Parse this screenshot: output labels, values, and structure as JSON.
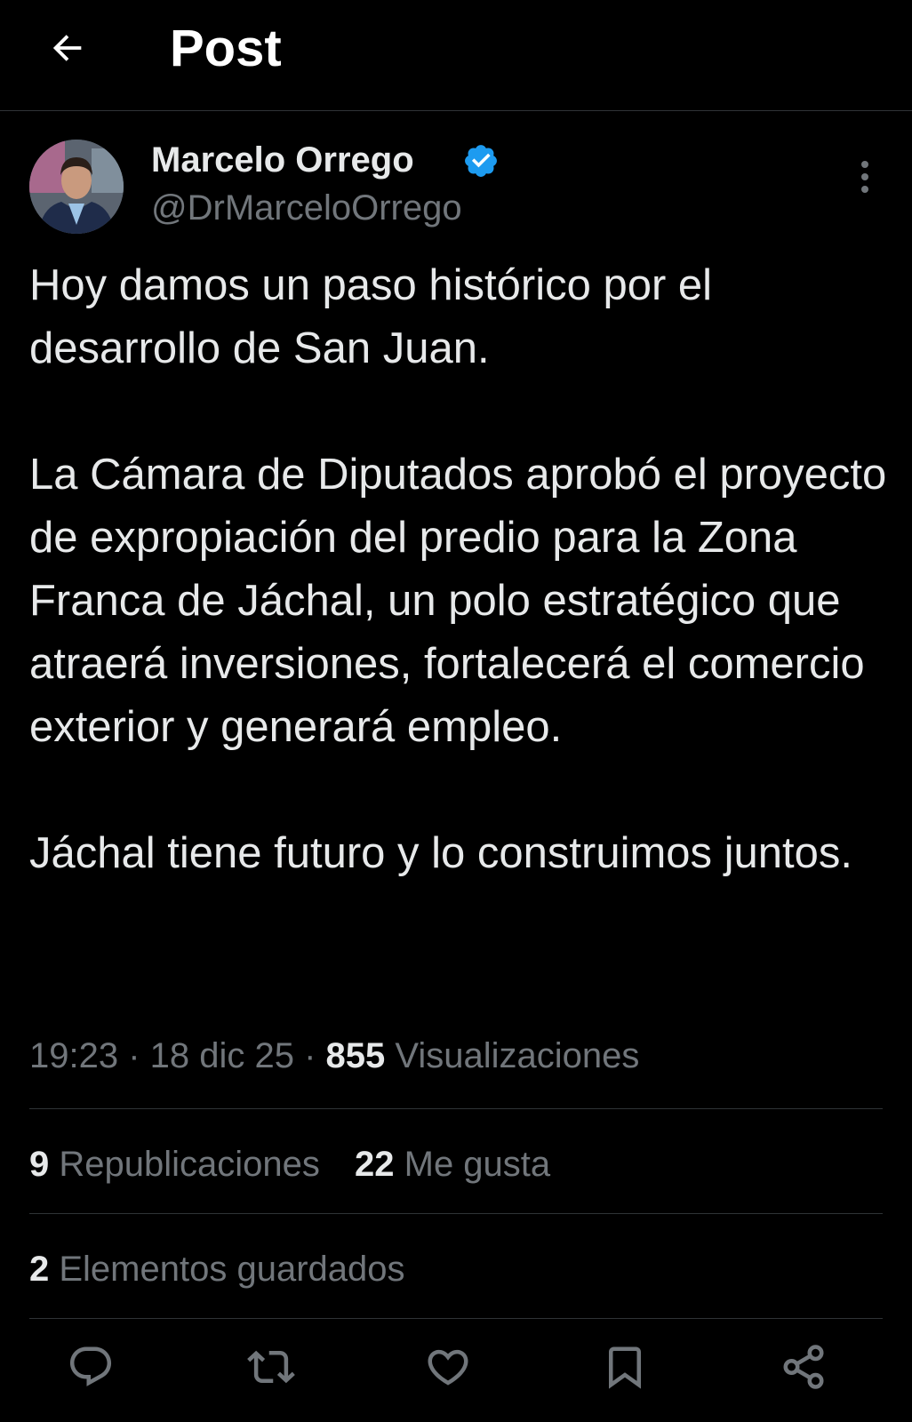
{
  "header": {
    "title": "Post",
    "back_icon": "arrow-left-icon"
  },
  "author": {
    "name": "Marcelo Orrego",
    "handle": "@DrMarceloOrrego",
    "verified": true,
    "verified_color": "#1d9bf0"
  },
  "post": {
    "paragraphs": [
      "Hoy damos un paso histórico por el desarrollo de San Juan.",
      "La Cámara de Diputados aprobó el proyecto de expropiación del predio para la Zona Franca de Jáchal, un polo estratégico que atraerá inversiones, fortalecerá el comercio exterior y generará empleo.",
      "Jáchal tiene futuro y lo construimos juntos."
    ],
    "time": "19:23",
    "date": "18 dic 25",
    "separator": " · ",
    "views_count": "855",
    "views_label": " Visualizaciones"
  },
  "stats": {
    "reposts_count": "9",
    "reposts_label": " Republicaciones",
    "likes_count": "22",
    "likes_label": " Me gusta",
    "bookmarks_count": "2",
    "bookmarks_label": " Elementos guardados"
  },
  "actions": [
    {
      "name": "reply",
      "icon": "reply-icon"
    },
    {
      "name": "repost",
      "icon": "repost-icon"
    },
    {
      "name": "like",
      "icon": "heart-icon"
    },
    {
      "name": "bookmark",
      "icon": "bookmark-icon"
    },
    {
      "name": "share",
      "icon": "share-icon"
    }
  ],
  "colors": {
    "background": "#000000",
    "text_primary": "#e7e9ea",
    "text_secondary": "#71767b",
    "divider": "#2f3336",
    "accent": "#1d9bf0"
  }
}
